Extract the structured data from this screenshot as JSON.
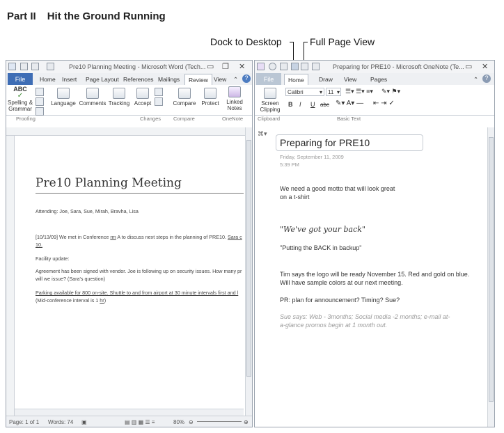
{
  "page": {
    "part": "Part II",
    "section": "Hit the Ground Running"
  },
  "callouts": {
    "dock": "Dock to Desktop",
    "fullpage": "Full Page View"
  },
  "word": {
    "title": "Pre10 Planning Meeting - Microsoft Word (Tech...",
    "tabs": [
      "File",
      "Home",
      "Insert",
      "Page Layout",
      "References",
      "Mailings",
      "Review",
      "View"
    ],
    "active_tab": "Review",
    "ribbon": {
      "spelling": "Spelling &",
      "grammar": "Grammar",
      "language": "Language",
      "comments": "Comments",
      "tracking": "Tracking",
      "accept": "Accept",
      "compare": "Compare",
      "protect": "Protect",
      "linked": "Linked",
      "notes": "Notes",
      "abc_glyph": "ABC"
    },
    "groups": [
      "Proofing",
      "Changes",
      "Compare",
      "OneNote"
    ],
    "document": {
      "title": "Pre10 Planning Meeting",
      "attending": "Attending: Joe, Sara, Sue, Mirah, Bravha, Lisa",
      "line1a": "[10/13/09] We met in Conference ",
      "line1_rm": "rm",
      "line1b": " A to discuss next steps in the planning of PRE10. ",
      "line1_sara": "Sara c",
      "line1_cont": "10.",
      "facility": "Facility update:",
      "agreement": "Agreement has been signed with vendor. Joe is following up on security issues. How many pr",
      "will_we": "will we issue? (Sara's question)",
      "parking": "Parking available for 800 on-site. Shuttle to and from airport at 30 minute intervals first and l",
      "midconf_a": "(Mid-conference interval is 1 ",
      "midconf_hr": "hr",
      "midconf_b": ")"
    },
    "status": {
      "page": "Page: 1 of 1",
      "words": "Words: 74",
      "zoom": "80%"
    }
  },
  "onenote": {
    "title": "Preparing for PRE10 - Microsoft OneNote (Te...",
    "tabs": [
      "File",
      "Home",
      "Draw",
      "View",
      "Pages"
    ],
    "active_tab": "Home",
    "ribbon": {
      "screen": "Screen",
      "clipping": "Clipping",
      "font": "Calibri",
      "size": "11",
      "bold": "B",
      "italic": "I",
      "underline": "U",
      "strike": "abc"
    },
    "groups": [
      "Clipboard",
      "Basic Text"
    ],
    "page": {
      "title": "Preparing for PRE10",
      "date": "Friday, September 11, 2009",
      "time": "5:39 PM",
      "motto1": "We need a good motto that will look great",
      "motto2": "on a t-shirt",
      "quote": "\"We've got your back\"",
      "backup": "\"Putting the BACK in backup\"",
      "logo1": "Tim says the logo will be ready November 15. Red and gold on blue.",
      "logo2": "Will have sample colors at our next meeting.",
      "pr": "PR: plan for announcement? Timing? Sue?",
      "sue1": "Sue says: Web - 3months; Social media -2 months; e-mail at-",
      "sue2": "a-glance promos begin at 1 month out."
    }
  }
}
